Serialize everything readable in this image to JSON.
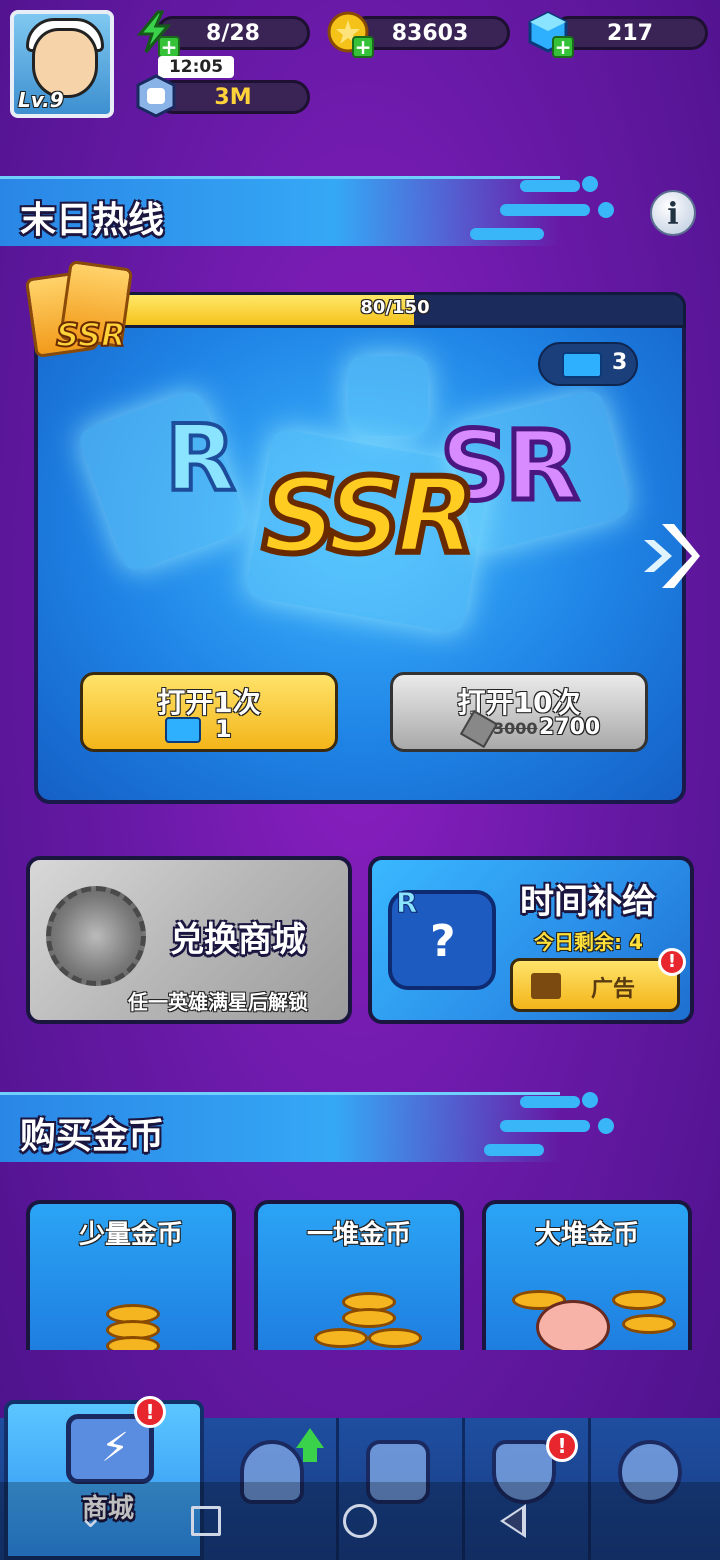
{
  "player": {
    "level_label": "Lv.9",
    "energy": "8/28",
    "energy_timer": "12:05",
    "coins": "83603",
    "gems": "217",
    "power": "3M"
  },
  "doomsday_hotline": {
    "title": "末日热线",
    "progress_text": "80/150",
    "progress_fraction": 0.533,
    "ticket_count": "3",
    "rank_labels": [
      "R",
      "SSR",
      "SR"
    ],
    "ssr_badge": "SSR",
    "open_once": {
      "label": "打开1次",
      "cost": "1"
    },
    "open_ten": {
      "label": "打开10次",
      "old_price": "3000",
      "price": "2700"
    }
  },
  "exchange_shop": {
    "title": "兑换商城",
    "subtitle": "任一英雄满星后解锁"
  },
  "time_supply": {
    "title": "时间补给",
    "remaining_label": "今日剩余: 4",
    "ad_label": "广告",
    "alert": "!"
  },
  "buy_coins": {
    "title": "购买金币",
    "packs": [
      {
        "label": "少量金币"
      },
      {
        "label": "一堆金币"
      },
      {
        "label": "大堆金币"
      }
    ]
  },
  "nav": {
    "shop_label": "商城",
    "alert": "!"
  },
  "colors": {
    "background": "#6a1aa8",
    "banner_blue": "#35a8f5",
    "gold": "#f5c21a",
    "alert_red": "#e8262e"
  }
}
